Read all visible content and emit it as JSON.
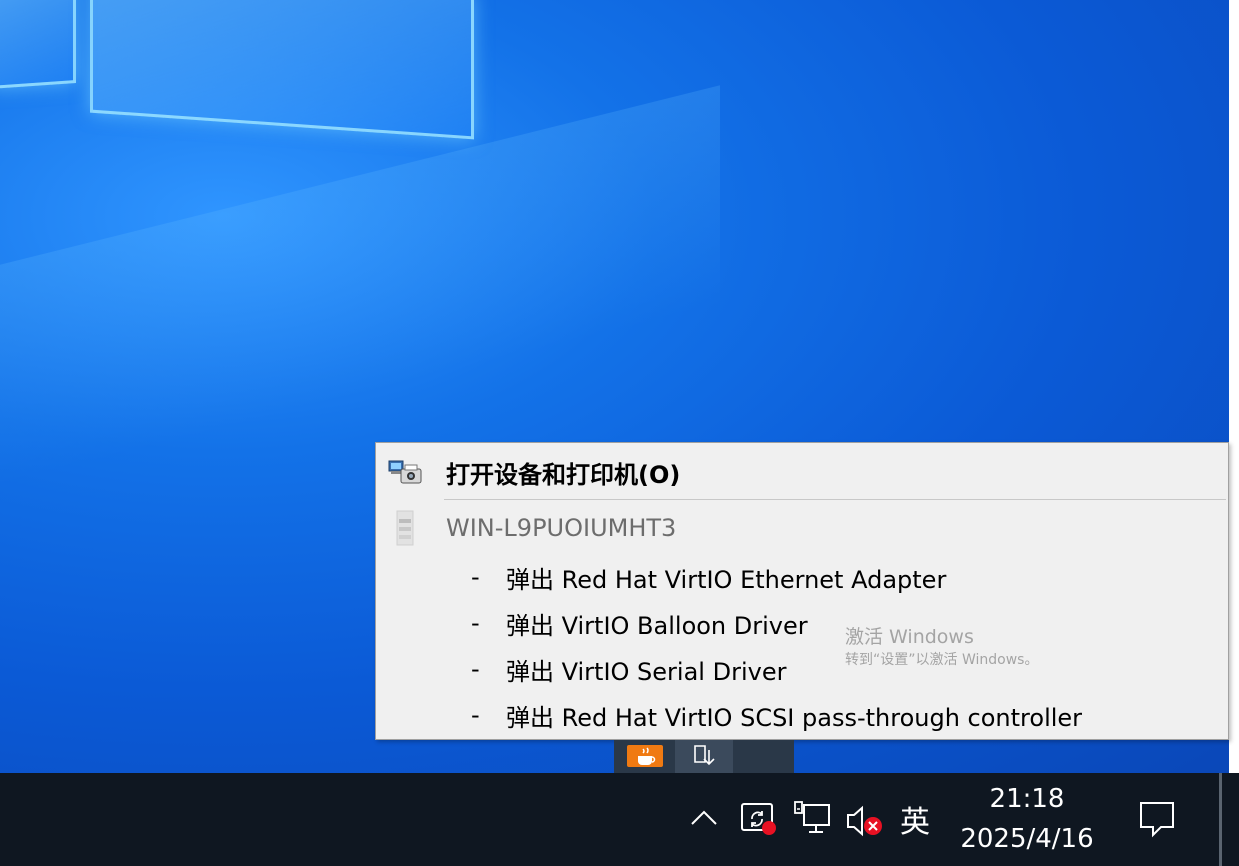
{
  "context_menu": {
    "open_devices_label": "打开设备和打印机(O)",
    "device_name": "WIN-L9PUOIUMHT3",
    "eject_items": [
      {
        "dash": "-",
        "label": "弹出 Red Hat VirtIO Ethernet Adapter"
      },
      {
        "dash": "-",
        "label": "弹出 VirtIO Balloon Driver"
      },
      {
        "dash": "-",
        "label": "弹出 VirtIO Serial Driver"
      },
      {
        "dash": "-",
        "label": "弹出 Red Hat VirtIO SCSI pass-through controller"
      }
    ]
  },
  "watermark": {
    "line1": "激活 Windows",
    "line2": "转到“设置”以激活 Windows。"
  },
  "overflow_tray": {
    "icons": [
      "java-icon",
      "safely-remove-hardware-icon"
    ]
  },
  "taskbar": {
    "tray_icons": [
      "chevron-up-icon",
      "sync-error-icon",
      "network-icon",
      "volume-muted-icon"
    ],
    "ime_label": "英",
    "time": "21:18",
    "date": "2025/4/16",
    "notification_icon": "action-center-icon"
  },
  "colors": {
    "taskbar_bg": "#0f1721",
    "menu_bg": "#f0f0f0",
    "error_red": "#e81123"
  }
}
